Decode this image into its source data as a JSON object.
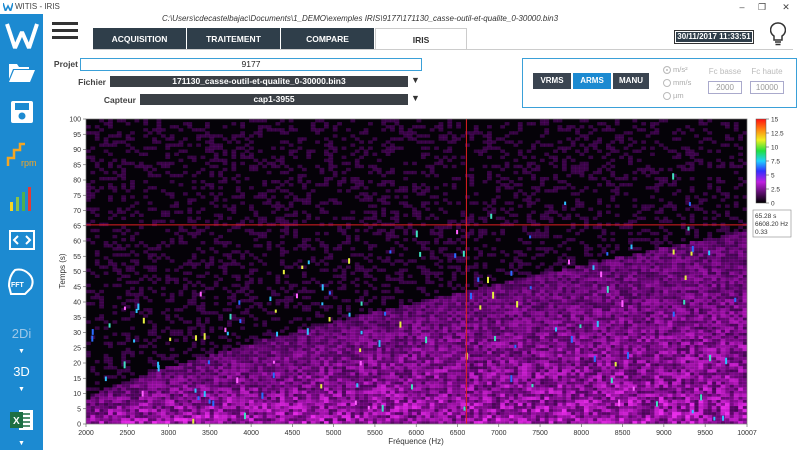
{
  "window": {
    "title": "WITIS - IRIS",
    "minimize": "–",
    "maximize": "❐",
    "close": "✕"
  },
  "file_path": "C:\\Users\\cdecastelbajac\\Documents\\1_DEMO\\exemples IRIS\\9177\\171130_casse-outil-et-qualite_0-30000.bin3",
  "tabs": [
    {
      "label": "ACQUISITION",
      "active": false
    },
    {
      "label": "TRAITEMENT",
      "active": false
    },
    {
      "label": "COMPARE",
      "active": false
    },
    {
      "label": "IRIS",
      "active": true
    }
  ],
  "datetime": "30/11/2017 11:33:51",
  "fields": {
    "projet_label": "Projet",
    "projet_value": "9177",
    "fichier_label": "Fichier",
    "fichier_value": "171130_casse-outil-et-qualite_0-30000.bin3",
    "capteur_label": "Capteur",
    "capteur_value": "cap1-3955"
  },
  "filter": {
    "modes": [
      {
        "label": "VRMS",
        "active": false
      },
      {
        "label": "ARMS",
        "active": true
      },
      {
        "label": "MANU",
        "active": false
      }
    ],
    "units": [
      {
        "label": "m/s²",
        "selected": true
      },
      {
        "label": "mm/s",
        "selected": false
      },
      {
        "label": "µm",
        "selected": false
      }
    ],
    "fc_basse_label": "Fc basse",
    "fc_basse_value": "2000",
    "fc_haute_label": "Fc haute",
    "fc_haute_value": "10000"
  },
  "sidebar": {
    "text_2d": "2Di",
    "text_3d": "3D",
    "rpm_label": "rpm",
    "fft_label": "FFT",
    "excel_label": "X"
  },
  "colors": {
    "sidebar": "#1c8ad1",
    "tab_dark": "#2f3e4a",
    "accent_blue": "#3aa0d8",
    "cursor": "#e02020"
  },
  "chart_data": {
    "type": "heatmap",
    "xlabel": "Fréquence (Hz)",
    "ylabel": "Temps (s)",
    "xlim": [
      2000,
      10007
    ],
    "ylim": [
      0,
      100
    ],
    "x_ticks": [
      2000,
      2500,
      3000,
      3500,
      4000,
      4500,
      5000,
      5500,
      6000,
      6500,
      7000,
      7500,
      8000,
      8500,
      9000,
      9500,
      10007
    ],
    "y_ticks": [
      0,
      5,
      10,
      15,
      20,
      25,
      30,
      35,
      40,
      45,
      50,
      55,
      60,
      65,
      70,
      75,
      80,
      85,
      90,
      95,
      100
    ],
    "colorbar": {
      "min": 0,
      "max": 15,
      "ticks": [
        "15",
        "12.5",
        "10",
        "7.5",
        "5",
        "2.5",
        "0"
      ]
    },
    "cursor": {
      "x": 6608.2,
      "y": 65.28,
      "value": 0.33
    },
    "cursor_readout": [
      "65.28 s",
      "6608.20 Hz",
      "0.33"
    ]
  }
}
